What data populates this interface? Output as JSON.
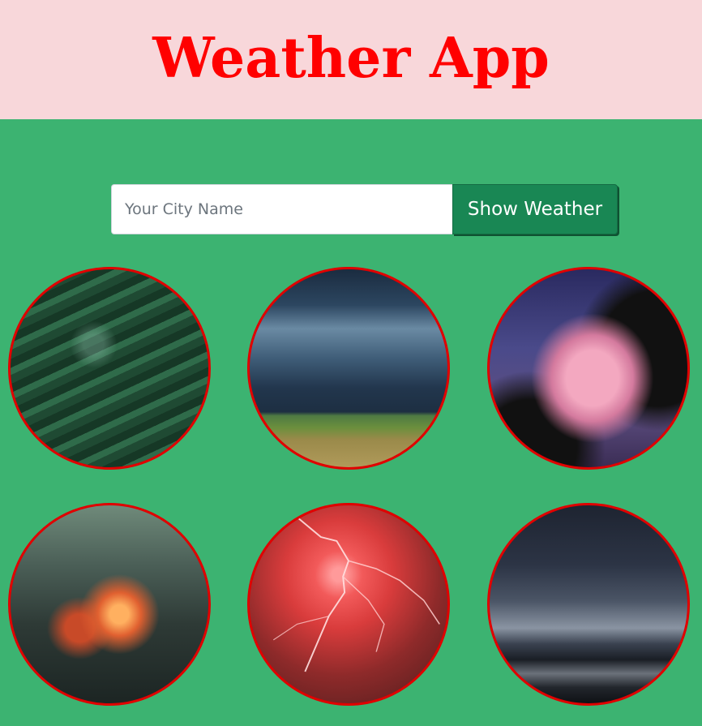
{
  "header": {
    "title": "Weather App",
    "background": "#f8d7da",
    "title_color": "#ff0000"
  },
  "main": {
    "background": "#3cb371"
  },
  "search": {
    "placeholder": "Your City Name",
    "value": "",
    "button_label": "Show Weather",
    "button_color": "#198754"
  },
  "gallery": {
    "border_color": "#e00000",
    "images": [
      {
        "name": "leaves-with-raindrops"
      },
      {
        "name": "storm-clouds-over-field"
      },
      {
        "name": "pink-cloud-with-trees"
      },
      {
        "name": "sunset-clouds"
      },
      {
        "name": "red-lightning"
      },
      {
        "name": "dark-clouds-over-lake"
      }
    ]
  }
}
